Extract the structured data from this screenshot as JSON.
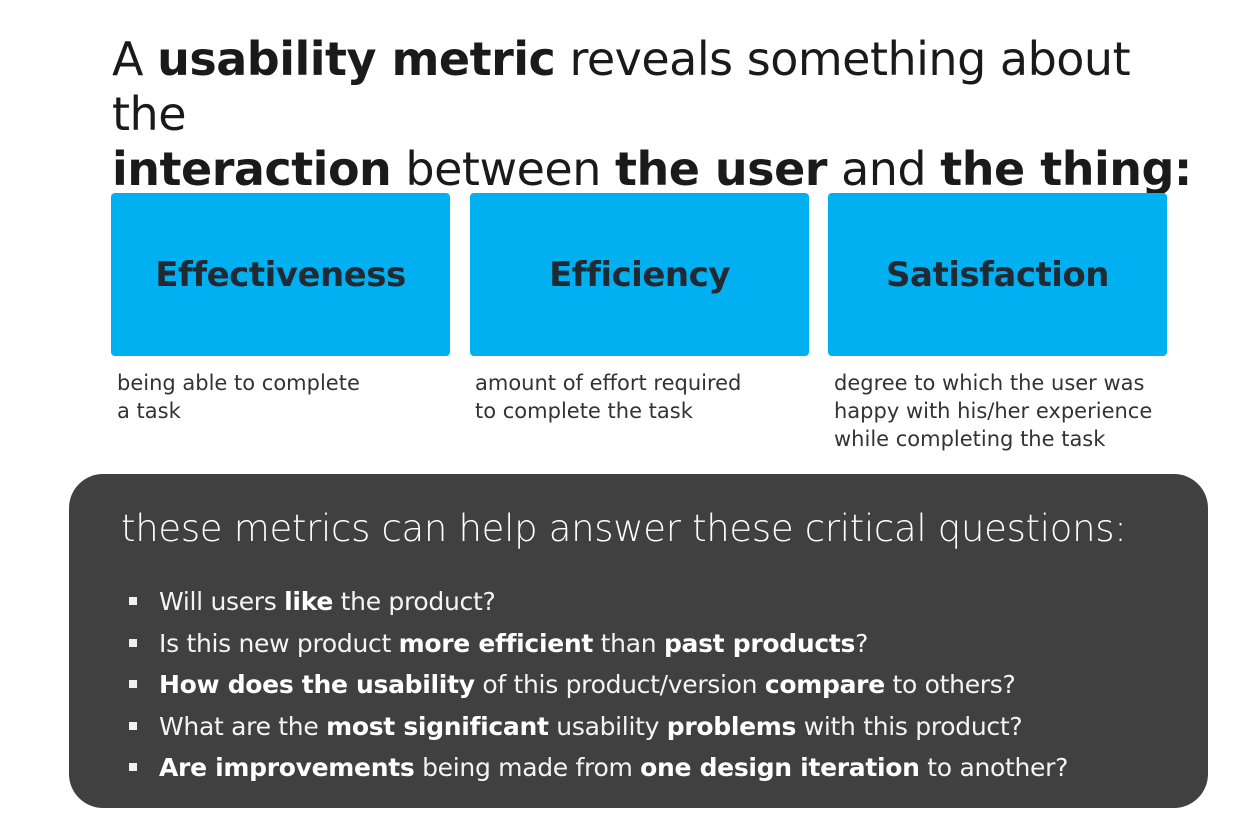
{
  "headline": {
    "line1": [
      {
        "text": "A ",
        "bold": false
      },
      {
        "text": "usability metric",
        "bold": true
      },
      {
        "text": " reveals something about the",
        "bold": false
      }
    ],
    "line2": [
      {
        "text": "interaction",
        "bold": true
      },
      {
        "text": " between ",
        "bold": false
      },
      {
        "text": "the user",
        "bold": true
      },
      {
        "text": " and ",
        "bold": false
      },
      {
        "text": "the thing:",
        "bold": true
      }
    ]
  },
  "tiles": [
    {
      "label": "Effectiveness",
      "description": "being able to complete\na task"
    },
    {
      "label": "Efficiency",
      "description": "amount of effort required\nto complete the task"
    },
    {
      "label": "Satisfaction",
      "description": "degree to which the user was\nhappy with his/her experience\nwhile completing the task"
    }
  ],
  "panel": {
    "heading": "these metrics can help answer these critical questions:",
    "questions": [
      [
        {
          "text": "Will users ",
          "bold": false
        },
        {
          "text": "like",
          "bold": true
        },
        {
          "text": " the product?",
          "bold": false
        }
      ],
      [
        {
          "text": "Is this new product ",
          "bold": false
        },
        {
          "text": "more efficient",
          "bold": true
        },
        {
          "text": " than ",
          "bold": false
        },
        {
          "text": "past products",
          "bold": true
        },
        {
          "text": "?",
          "bold": false
        }
      ],
      [
        {
          "text": "How does the usability",
          "bold": true
        },
        {
          "text": " of this product/version ",
          "bold": false
        },
        {
          "text": "compare",
          "bold": true
        },
        {
          "text": " to others?",
          "bold": false
        }
      ],
      [
        {
          "text": "What are the ",
          "bold": false
        },
        {
          "text": "most significant",
          "bold": true
        },
        {
          "text": " usability ",
          "bold": false
        },
        {
          "text": "problems",
          "bold": true
        },
        {
          "text": " with this product?",
          "bold": false
        }
      ],
      [
        {
          "text": "Are improvements",
          "bold": true
        },
        {
          "text": " being made from ",
          "bold": false
        },
        {
          "text": "one design iteration",
          "bold": true
        },
        {
          "text": " to another?",
          "bold": false
        }
      ]
    ]
  },
  "colors": {
    "tile_fill": "#00b0f0",
    "tile_text": "#1f2a33",
    "panel_fill": "#404040",
    "panel_text": "#ffffff"
  }
}
